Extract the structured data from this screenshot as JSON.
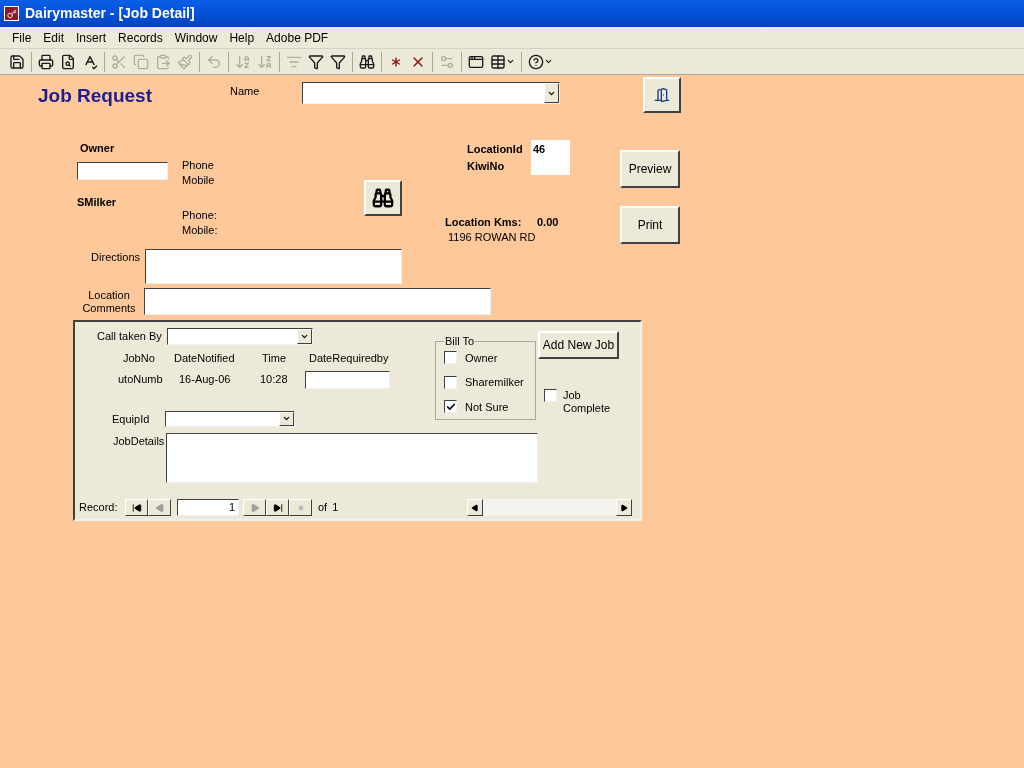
{
  "window": {
    "title": "Dairymaster - [Job Detail]"
  },
  "menu": [
    {
      "label": "File"
    },
    {
      "label": "Edit"
    },
    {
      "label": "Insert"
    },
    {
      "label": "Records"
    },
    {
      "label": "Window"
    },
    {
      "label": "Help"
    },
    {
      "label": "Adobe PDF"
    }
  ],
  "toolbar": [
    {
      "kind": "save",
      "disabled": false
    },
    {
      "kind": "separator"
    },
    {
      "kind": "print",
      "disabled": false
    },
    {
      "kind": "preview",
      "disabled": false
    },
    {
      "kind": "spelling",
      "disabled": false
    },
    {
      "kind": "separator"
    },
    {
      "kind": "cut",
      "disabled": true
    },
    {
      "kind": "copy",
      "disabled": true
    },
    {
      "kind": "paste",
      "disabled": true
    },
    {
      "kind": "format_painter",
      "disabled": true
    },
    {
      "kind": "separator"
    },
    {
      "kind": "undo",
      "disabled": true
    },
    {
      "kind": "separator"
    },
    {
      "kind": "sort_asc",
      "disabled": true
    },
    {
      "kind": "sort_desc",
      "disabled": true
    },
    {
      "kind": "separator"
    },
    {
      "kind": "filter_selection",
      "disabled": true
    },
    {
      "kind": "filter_form",
      "disabled": false
    },
    {
      "kind": "apply_filter",
      "disabled": false
    },
    {
      "kind": "separator"
    },
    {
      "kind": "find",
      "disabled": false
    },
    {
      "kind": "separator"
    },
    {
      "kind": "new_record",
      "disabled": false
    },
    {
      "kind": "delete_record",
      "disabled": false
    },
    {
      "kind": "separator"
    },
    {
      "kind": "properties",
      "disabled": true
    },
    {
      "kind": "separator"
    },
    {
      "kind": "database_window",
      "disabled": false
    },
    {
      "kind": "new_object",
      "disabled": false
    },
    {
      "kind": "separator"
    },
    {
      "kind": "help",
      "disabled": false
    }
  ],
  "form": {
    "title": "Job Request",
    "name_label": "Name",
    "owner": {
      "label": "Owner",
      "phone_label": "Phone",
      "mobile_label": "Mobile"
    },
    "sharemilker": {
      "label": "SMilker",
      "phone_label": "Phone:",
      "mobile_label": "Mobile:"
    },
    "location": {
      "id_label": "LocationId",
      "id_value": "46",
      "kiwi_label": "KiwiNo",
      "kms_label": "Location Kms:",
      "kms_value": "0.00",
      "address": "1196 ROWAN RD"
    },
    "preview_button": "Preview",
    "print_button": "Print",
    "directions_label": "Directions",
    "location_comments_label": "Location Comments"
  },
  "job": {
    "call_taken_by_label": "Call taken By",
    "columns": [
      "JobNo",
      "DateNotified",
      "Time",
      "DateRequiredby"
    ],
    "values": [
      "utoNumb",
      "16-Aug-06",
      "10:28"
    ],
    "bill_to": {
      "title": "Bill To",
      "options": [
        {
          "label": "Owner",
          "checked": false
        },
        {
          "label": "Sharemilker",
          "checked": false
        },
        {
          "label": "Not Sure",
          "checked": true
        }
      ]
    },
    "add_button": "Add New Job",
    "job_complete": {
      "label": "Job Complete",
      "checked": false
    },
    "equip_label": "EquipId",
    "details_label": "JobDetails"
  },
  "record_nav": {
    "label": "Record:",
    "current": "1",
    "of_label": "of",
    "total": "1",
    "buttons": [
      {
        "kind": "first",
        "disabled": false
      },
      {
        "kind": "prev",
        "disabled": true
      },
      {
        "kind": "next",
        "disabled": true
      },
      {
        "kind": "last",
        "disabled": false
      },
      {
        "kind": "new",
        "disabled": true
      }
    ]
  }
}
